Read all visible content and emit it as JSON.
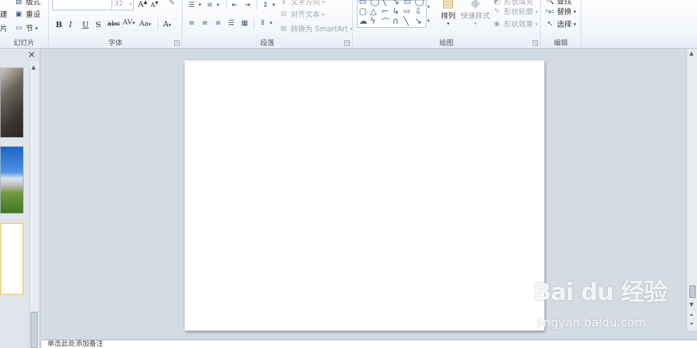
{
  "ribbon": {
    "slides_group": {
      "label": "幻灯片",
      "layout_label": "版式",
      "reset_label": "重设",
      "section_label": "节",
      "new_fragment": "建",
      "new_fragment2": "片"
    },
    "font_group": {
      "label": "字体",
      "font_size": "32"
    },
    "paragraph_group": {
      "label": "段落",
      "text_direction": "文字方向",
      "align_text": "对齐文本",
      "convert_smartart": "转换为 SmartArt"
    },
    "drawing_group": {
      "label": "绘图",
      "arrange": "排列",
      "quick_styles": "快速样式",
      "shape_fill": "形状填充",
      "shape_outline": "形状轮廓",
      "shape_effects": "形状效果"
    },
    "editing_group": {
      "label": "编辑",
      "find": "查找",
      "replace": "替换",
      "select": "选择"
    }
  },
  "notes": {
    "placeholder": "单击此处添加备注"
  },
  "watermark": {
    "logo": "Bai du 经验",
    "url": "jingyan.baidu.com"
  },
  "colors": {
    "ribbon_bg": "#f3f6fa",
    "workspace_bg": "#d5dbe3",
    "slide_bg": "#ffffff",
    "selected_thumb_border": "#f0d48a"
  }
}
